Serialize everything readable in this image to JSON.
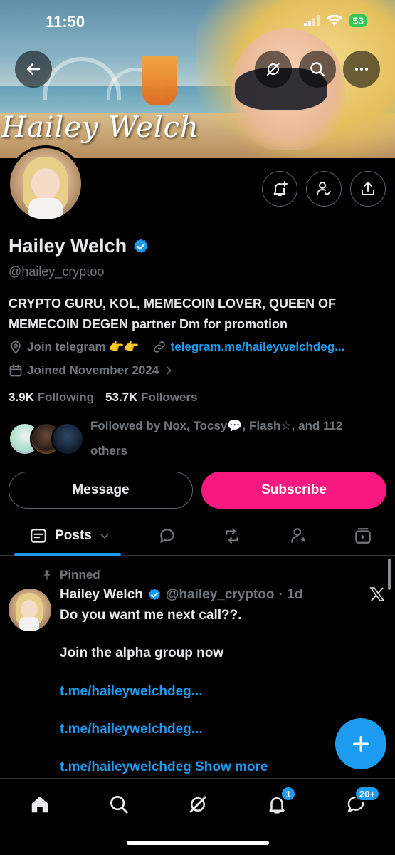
{
  "status_bar": {
    "time": "11:50",
    "battery": "53"
  },
  "banner": {
    "art_text": "Hailey Welch"
  },
  "profile": {
    "display_name": "Hailey Welch",
    "handle": "@hailey_cryptoo",
    "bio": "CRYPTO GURU, KOL, MEMECOIN LOVER, QUEEN OF MEMECOIN DEGEN partner Dm for promotion",
    "location": "Join telegram 👉👉",
    "website": "telegram.me/haileywelchdeg...",
    "joined": "Joined November 2024",
    "following_count": "3.9K",
    "following_label": "Following",
    "followers_count": "53.7K",
    "followers_label": "Followers",
    "followed_by": "Followed by Nox, Tocsy💬, Flash☆, and 112 others"
  },
  "actions": {
    "message_label": "Message",
    "subscribe_label": "Subscribe"
  },
  "tabs": {
    "posts_label": "Posts"
  },
  "post": {
    "pinned_label": "Pinned",
    "author_name": "Hailey Welch",
    "author_handle": "@hailey_cryptoo",
    "time": "· 1d",
    "line1": "Do you want me next call??.",
    "line2": "Join the alpha group now",
    "link1": "t.me/haileywelchdeg...",
    "link2": "t.me/haileywelchdeg...",
    "link3": "t.me/haileywelchdeg",
    "show_more": "Show more"
  },
  "nav": {
    "notifications_badge": "1",
    "messages_badge": "20+"
  },
  "colors": {
    "accent": "#1d9bf0",
    "subscribe": "#f91880",
    "background": "#000000",
    "muted": "#71767b"
  }
}
